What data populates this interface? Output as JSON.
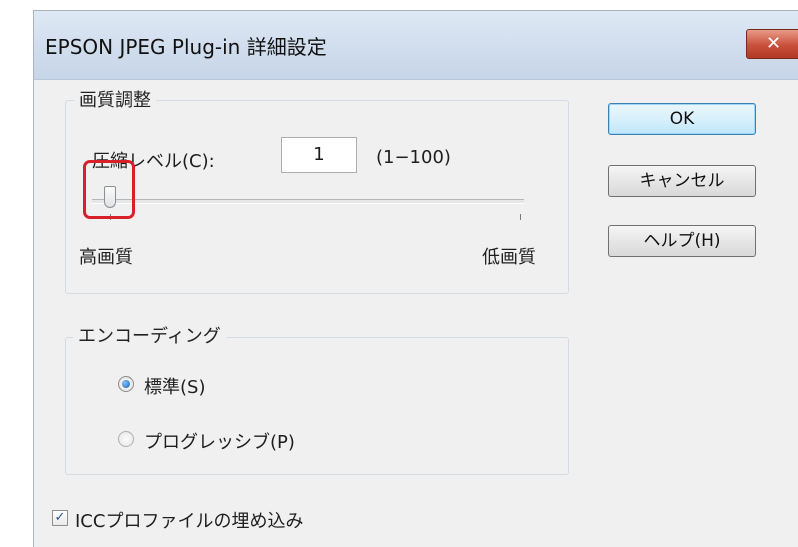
{
  "window": {
    "title": "EPSON JPEG Plug-in 詳細設定",
    "close_icon": "close-icon"
  },
  "quality_group": {
    "legend": "画質調整",
    "compression_label": "圧縮レベル(C):",
    "compression_value": "1",
    "range_hint": "(1−100)",
    "slider_value": 1,
    "slider_range": [
      1,
      100
    ],
    "left_label": "高画質",
    "right_label": "低画質"
  },
  "encoding_group": {
    "legend": "エンコーディング",
    "options": [
      {
        "label": "標準(S)",
        "selected": true
      },
      {
        "label": "プログレッシブ(P)",
        "selected": false
      }
    ]
  },
  "icc": {
    "label": "ICCプロファイルの埋め込み",
    "checked": true,
    "check_mark": "✓"
  },
  "buttons": {
    "ok": "OK",
    "cancel": "キャンセル",
    "help": "ヘルプ(H)"
  },
  "highlight": {
    "color": "#d8202a"
  }
}
